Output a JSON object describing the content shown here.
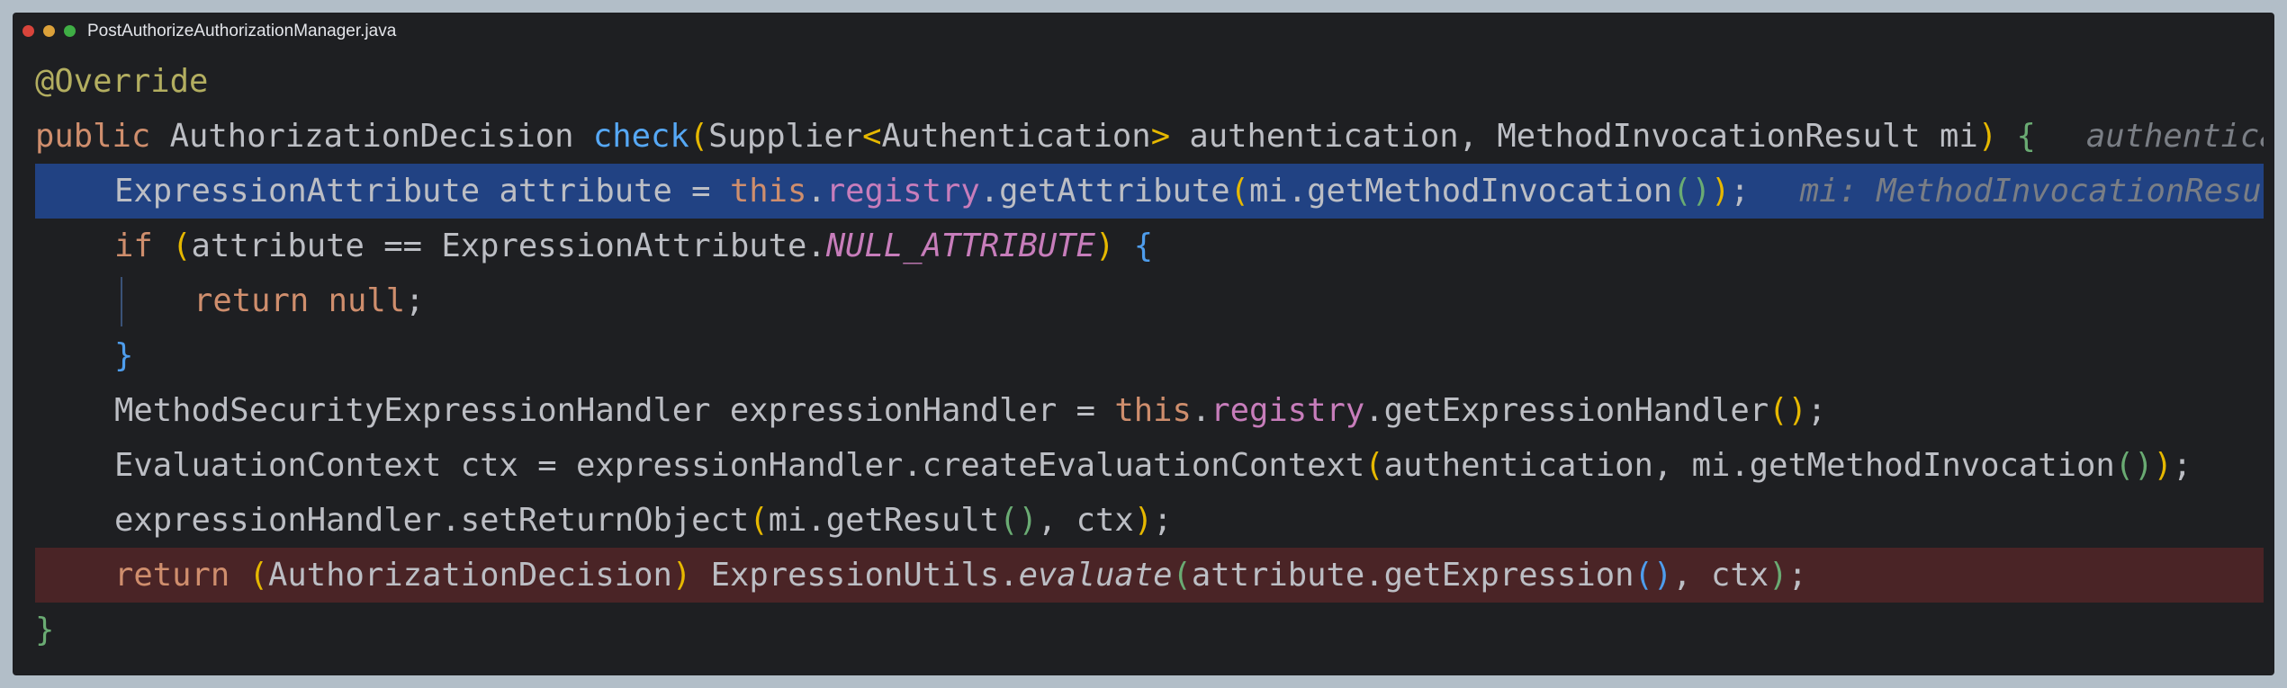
{
  "window": {
    "title": "PostAuthorizeAuthorizationManager.java"
  },
  "colors": {
    "background": "#1e1f22",
    "keyword": "#cf8e6d",
    "method_declaration": "#56a8f5",
    "field": "#c77dbb",
    "annotation": "#b3ae60",
    "current_line_highlight": "#214283",
    "breakpoint_line_highlight": "#4a2426"
  },
  "code": {
    "l1": {
      "annotation": "@Override"
    },
    "l2": {
      "public": "public",
      "ret_type": "AuthorizationDecision",
      "name": "check",
      "open_paren": "(",
      "p1_type": "Supplier",
      "lt": "<",
      "p1_generic": "Authentication",
      "gt": ">",
      "p1_rest": " authentication, MethodInvocationResult mi",
      "close_paren": ")",
      "open_brace": "{",
      "hint": "authentication"
    },
    "l3": {
      "pre": "ExpressionAttribute attribute = ",
      "this": "this",
      "dot": ".",
      "field": "registry",
      "call": ".getAttribute",
      "p_open": "(",
      "arg": "mi.getMethodInvocation",
      "pg": "()",
      "p_close": ")",
      "semi": ";",
      "hint": "mi: MethodInvocationResult"
    },
    "l4": {
      "if": "if",
      "p_open": "(",
      "cond": "attribute == ExpressionAttribute.",
      "const": "NULL_ATTRIBUTE",
      "p_close": ")",
      "brace": "{"
    },
    "l5": {
      "return": "return",
      "null": "null",
      "semi": ";"
    },
    "l6": {
      "brace": "}"
    },
    "l7": {
      "pre": "MethodSecurityExpressionHandler expressionHandler = ",
      "this": "this",
      "dot": ".",
      "field": "registry",
      "call": ".getExpressionHandler",
      "parens": "()",
      "semi": ";"
    },
    "l8": {
      "pre": "EvaluationContext ctx = expressionHandler.createEvaluationContext",
      "p_open": "(",
      "args": "authentication, mi.getMethodInvocation",
      "pg": "()",
      "p_close": ")",
      "semi": ";"
    },
    "l9": {
      "pre": "expressionHandler.setReturnObject",
      "p_open": "(",
      "arg": "mi.getResult",
      "pg": "()",
      "rest": ", ctx",
      "p_close": ")",
      "semi": ";"
    },
    "l10": {
      "return": "return",
      "cast_open": "(",
      "cast_type": "AuthorizationDecision",
      "cast_close": ")",
      "utils": "ExpressionUtils.",
      "method": "evaluate",
      "p_open": "(",
      "arg": "attribute.getExpression",
      "pb": "()",
      "rest": ", ctx",
      "p_close": ")",
      "semi": ";"
    },
    "l11": {
      "brace": "}"
    }
  }
}
